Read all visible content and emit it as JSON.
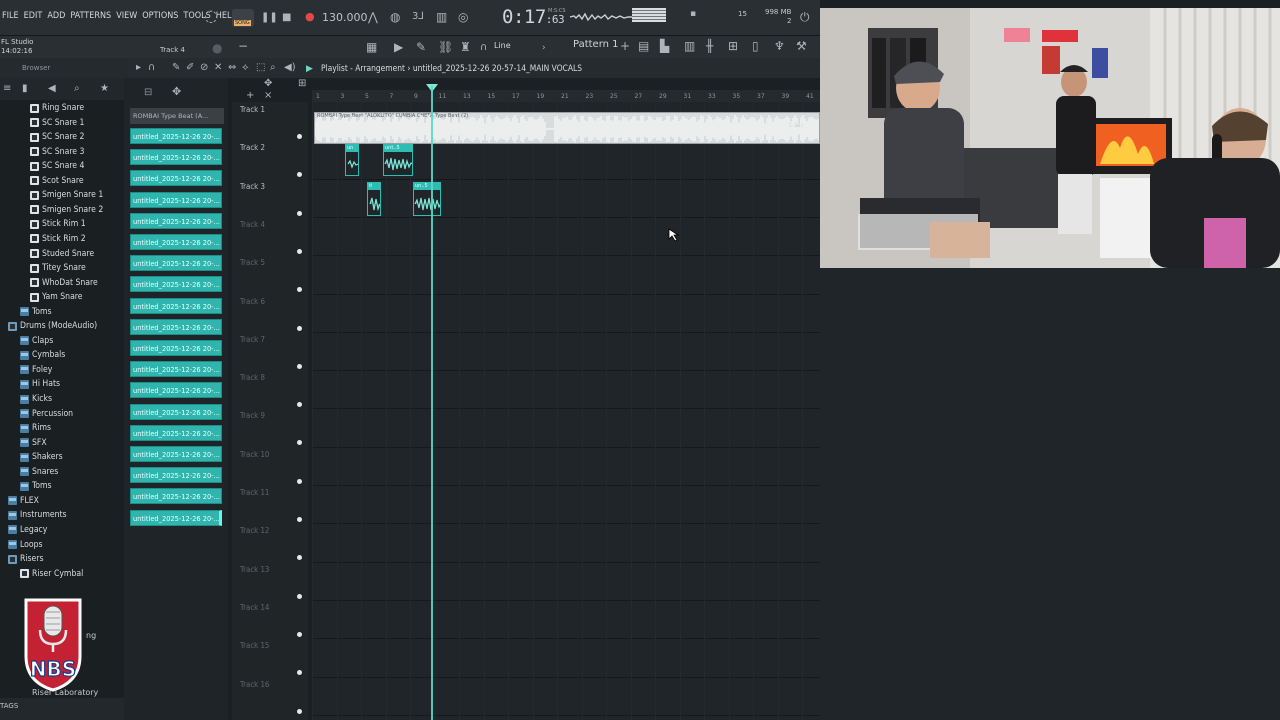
{
  "menu": [
    "FILE",
    "EDIT",
    "ADD",
    "PATTERNS",
    "VIEW",
    "OPTIONS",
    "TOOLS",
    "HELP"
  ],
  "transport": {
    "song_label": "SONG",
    "tempo": "130.000",
    "time_main": "0:17",
    "time_sub": ":63",
    "time_units": "M:S:CS",
    "cpu": "15",
    "mem_top": "998 MB",
    "mem_bottom": "2"
  },
  "row2": {
    "studio_line1": "FL Studio",
    "studio_line2": "14:02:16",
    "hint_track": "Track 4",
    "snap_mode": "Line",
    "pattern": "Pattern 1"
  },
  "browser": {
    "title": "Browser",
    "items": [
      {
        "label": "Ring Snare",
        "type": "file"
      },
      {
        "label": "SC Snare 1",
        "type": "file"
      },
      {
        "label": "SC Snare 2",
        "type": "file"
      },
      {
        "label": "SC Snare 3",
        "type": "file"
      },
      {
        "label": "SC Snare 4",
        "type": "file"
      },
      {
        "label": "Scot Snare",
        "type": "file"
      },
      {
        "label": "Smigen Snare 1",
        "type": "file"
      },
      {
        "label": "Smigen Snare 2",
        "type": "file"
      },
      {
        "label": "Stick Rim 1",
        "type": "file"
      },
      {
        "label": "Stick Rim 2",
        "type": "file"
      },
      {
        "label": "Studed Snare",
        "type": "file"
      },
      {
        "label": "Titey Snare",
        "type": "file"
      },
      {
        "label": "WhoDat Snare",
        "type": "file"
      },
      {
        "label": "Yam Snare",
        "type": "file"
      },
      {
        "label": "Toms",
        "type": "folder"
      },
      {
        "label": "Drums (ModeAudio)",
        "type": "open"
      },
      {
        "label": "Claps",
        "type": "folder"
      },
      {
        "label": "Cymbals",
        "type": "folder"
      },
      {
        "label": "Foley",
        "type": "folder"
      },
      {
        "label": "Hi Hats",
        "type": "folder"
      },
      {
        "label": "Kicks",
        "type": "folder"
      },
      {
        "label": "Percussion",
        "type": "folder"
      },
      {
        "label": "Rims",
        "type": "folder"
      },
      {
        "label": "SFX",
        "type": "folder"
      },
      {
        "label": "Shakers",
        "type": "folder"
      },
      {
        "label": "Snares",
        "type": "folder"
      },
      {
        "label": "Toms",
        "type": "folder"
      },
      {
        "label": "FLEX",
        "type": "folder"
      },
      {
        "label": "Instruments",
        "type": "folder"
      },
      {
        "label": "Legacy",
        "type": "folder"
      },
      {
        "label": "Loops",
        "type": "folder"
      },
      {
        "label": "Risers",
        "type": "open"
      },
      {
        "label": "Riser Cymbal",
        "type": "file"
      }
    ],
    "tags_label": "TAGS",
    "partial_a": "ng",
    "partial_b": "Riser Laboratory"
  },
  "picker": {
    "header": "ROMBAI Type Beat (A...",
    "clips": [
      "untitled_2025-12-26 20-...",
      "untitled_2025-12-26 20-...",
      "untitled_2025-12-26 20-...",
      "untitled_2025-12-26 20-...",
      "untitled_2025-12-26 20-...",
      "untitled_2025-12-26 20-...",
      "untitled_2025-12-26 20-...",
      "untitled_2025-12-26 20-...",
      "untitled_2025-12-26 20-...",
      "untitled_2025-12-26 20-...",
      "untitled_2025-12-26 20-...",
      "untitled_2025-12-26 20-...",
      "untitled_2025-12-26 20-...",
      "untitled_2025-12-26 20-...",
      "untitled_2025-12-26 20-...",
      "untitled_2025-12-26 20-...",
      "untitled_2025-12-26 20-...",
      "untitled_2025-12-26 20-...",
      "untitled_2025-12-26 20-..."
    ]
  },
  "playlist": {
    "title": "Playlist - Arrangement",
    "arrangement": "untitled_2025-12-26 20-57-14_MAIN VOCALS",
    "ruler": [
      "1",
      "3",
      "5",
      "7",
      "9",
      "11",
      "13",
      "15",
      "17",
      "19",
      "21",
      "23",
      "25",
      "27",
      "29",
      "31",
      "33",
      "35",
      "37",
      "39",
      "41"
    ],
    "tracks": [
      "Track 1",
      "Track 2",
      "Track 3",
      "Track 4",
      "Track 5",
      "Track 6",
      "Track 7",
      "Track 8",
      "Track 9",
      "Track 10",
      "Track 11",
      "Track 12",
      "Track 13",
      "Track 14",
      "Track 15",
      "Track 16"
    ],
    "clip_main_label": "ROMBAI Type Beat \"ALOKLITO\" CUMBIA CHETA Type Beat (2)",
    "clip_main_right": "1-Sub",
    "clip_small_a": "un",
    "clip_small_b": "unt..5",
    "clip_small_c": "ti",
    "clip_small_d": "un..5"
  },
  "logo_text": "NBS"
}
